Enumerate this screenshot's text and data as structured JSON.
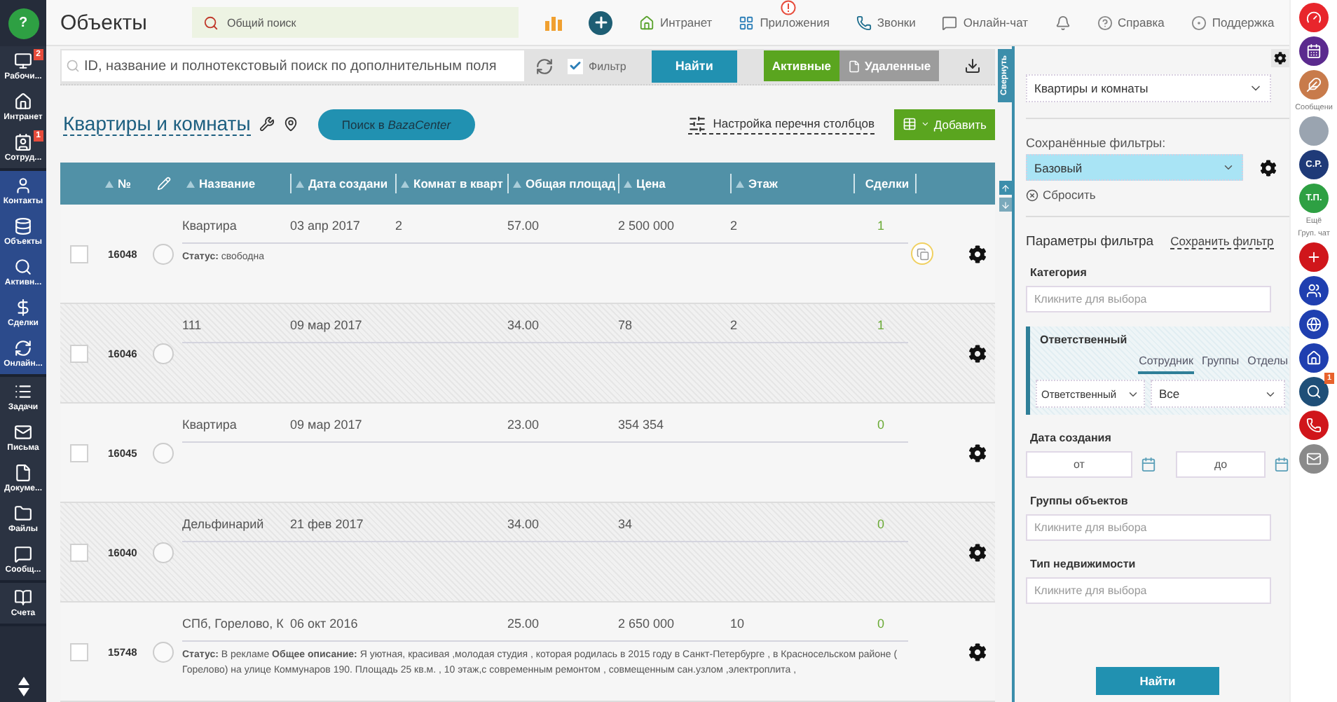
{
  "sidebar": {
    "help_button": "?",
    "groups": [
      {
        "color": "#2b3342",
        "items": [
          {
            "label": "Рабочи...",
            "badge": "2"
          },
          {
            "label": "Интранет"
          },
          {
            "label": "Сотруд...",
            "badge": "1"
          }
        ]
      },
      {
        "color": "#2c4b8c",
        "items": [
          {
            "label": "Контакты"
          },
          {
            "label": "Объекты"
          },
          {
            "label": "Активн..."
          },
          {
            "label": "Сделки"
          },
          {
            "label": "Онлайн..."
          }
        ]
      },
      {
        "color": "#2b3342",
        "items": [
          {
            "label": "Задачи"
          },
          {
            "label": "Письма"
          },
          {
            "label": "Докуме..."
          },
          {
            "label": "Файлы"
          },
          {
            "label": "Сообщ..."
          }
        ]
      },
      {
        "color": "#2b3342",
        "items": [
          {
            "label": "Счета"
          }
        ]
      }
    ]
  },
  "topbar": {
    "title": "Объекты",
    "search_placeholder": "Общий поиск",
    "links": [
      {
        "kind": "link",
        "label": "Интранет",
        "alert": false
      },
      {
        "kind": "link",
        "label": "Приложения",
        "alert": true
      },
      {
        "kind": "link",
        "label": "Звонки",
        "alert": false
      },
      {
        "kind": "link",
        "label": "Онлайн-чат",
        "alert": false
      },
      {
        "kind": "icon",
        "alert": false
      },
      {
        "kind": "link",
        "label": "Справка",
        "alert": false
      },
      {
        "kind": "link",
        "label": "Поддержка",
        "alert": false
      }
    ]
  },
  "search_bar": {
    "placeholder": "ID, название и полнотекстовый поиск по дополнительным поля",
    "filter": {
      "label": "Фильтр",
      "checked": true
    },
    "find_button": "Найти",
    "toggle": [
      {
        "label": "Активные",
        "selected": true
      },
      {
        "label": "Удаленные",
        "selected": false
      }
    ]
  },
  "collapse_tab": "Свернуть",
  "heading": {
    "title": "Квартиры и комнаты",
    "search_button": "Поиск в *BazaCenter*",
    "columns_link": "Настройка перечня столбцов",
    "add_button": "Добавить"
  },
  "table": {
    "columns": [
      {
        "label": "№",
        "sortable": true
      },
      {
        "label": "Название",
        "sortable": true
      },
      {
        "label": "Дата создани",
        "sortable": true
      },
      {
        "label": "Комнат в кварт",
        "sortable": true
      },
      {
        "label": "Общая площад",
        "sortable": true
      },
      {
        "label": "Цена",
        "sortable": true
      },
      {
        "label": "Этаж",
        "sortable": true
      },
      {
        "label": "Сделки",
        "sortable": false
      }
    ],
    "rows": [
      {
        "highlighted": false,
        "copy": true,
        "cells": [
          "16048",
          "Квартира",
          "03 апр 2017",
          "2",
          "57.00",
          "2 500 000",
          "2",
          "1"
        ],
        "details": "**Статус:** свободна"
      },
      {
        "highlighted": true,
        "copy": false,
        "cells": [
          "16046",
          "111",
          "09 мар 2017",
          null,
          "34.00",
          "78",
          "2",
          "1"
        ]
      },
      {
        "highlighted": false,
        "copy": false,
        "cells": [
          "16045",
          "Квартира",
          "09 мар 2017",
          null,
          "23.00",
          "354 354",
          null,
          "0"
        ]
      },
      {
        "highlighted": true,
        "copy": false,
        "cells": [
          "16040",
          "Дельфинарий",
          "21 фев 2017",
          null,
          "34.00",
          "34",
          null,
          "0"
        ]
      },
      {
        "highlighted": false,
        "copy": false,
        "cells": [
          "15748",
          "СПб, Горелово, К",
          "06 окт 2016",
          null,
          "25.00",
          "2 650 000",
          "10",
          "0"
        ],
        "details": "**Статус:** В рекламе   **Общее описание:** Я уютная, красивая ,молодая студия , которая родилась в 2015 году в Санкт-Петербурге , в Красносельском районе ( Горелово) на улице Коммунаров 190. Площадь 25 кв.м. , 10 этаж,с современным ремонтом , совмещенным сан.узлом ,электроплита ,"
      }
    ]
  },
  "filter_panel": {
    "type_select": "Квартиры и комнаты",
    "saved_label": "Сохранённые фильтры:",
    "saved_select": "Базовый",
    "reset": "Сбросить",
    "params_title": "Параметры фильтра",
    "save_link": "Сохранить фильтр",
    "fields": [
      {
        "kind": "picker",
        "label": "Категория",
        "placeholder": "Кликните для выбора"
      },
      {
        "kind": "responsible",
        "label": "Ответственный",
        "tabs": [
          {
            "label": "Сотрудник",
            "selected": true
          },
          {
            "label": "Группы",
            "selected": false
          },
          {
            "label": "Отделы",
            "selected": false
          }
        ],
        "role_select": "Ответственный",
        "scope_select": "Все"
      },
      {
        "kind": "date_range",
        "label": "Дата создания",
        "from_placeholder": "от",
        "to_placeholder": "до"
      },
      {
        "kind": "picker",
        "label": "Группы объектов",
        "placeholder": "Кликните для выбора"
      },
      {
        "kind": "picker",
        "label": "Тип недвижимости",
        "placeholder": "Кликните для выбора"
      }
    ],
    "find_button": "Найти"
  },
  "right_rail": [
    {
      "kind": "icon",
      "color": "#e8262c"
    },
    {
      "kind": "icon",
      "color": "#5b2a8e"
    },
    {
      "kind": "icon",
      "color": "#c87b4b",
      "caption": "Сообщени"
    },
    {
      "kind": "avatar"
    },
    {
      "kind": "initials",
      "text": "С.Р.",
      "color": "#1f3a78"
    },
    {
      "kind": "initials",
      "text": "Т.П.",
      "color": "#2ea043",
      "caption": "Ещё"
    },
    {
      "kind": "label",
      "text": "Груп. чат"
    },
    {
      "kind": "icon",
      "color": "#d0161b"
    },
    {
      "kind": "icon",
      "color": "#1f3fb0"
    },
    {
      "kind": "icon",
      "color": "#1f3fb0"
    },
    {
      "kind": "icon",
      "color": "#1f3fb0"
    },
    {
      "kind": "icon",
      "color": "#1f4f78",
      "badge": "1"
    },
    {
      "kind": "icon",
      "color": "#d0161b"
    },
    {
      "kind": "icon",
      "color": "#8a8a8a"
    }
  ]
}
